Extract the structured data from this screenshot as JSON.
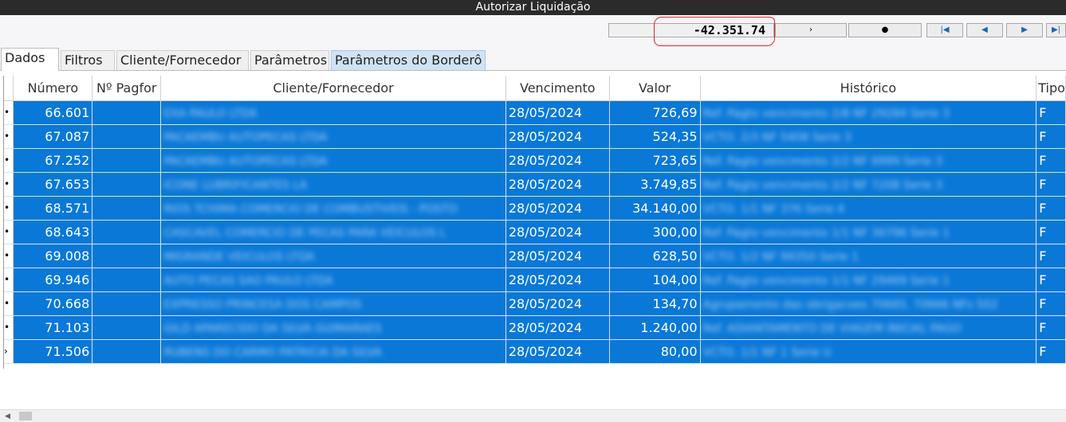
{
  "window": {
    "title": "Autorizar Liquidação"
  },
  "toolbar": {
    "total": "-42.351.74",
    "nav_next_glyph": "›",
    "nav_record_glyph": "●",
    "nav_first_glyph": "|◀",
    "nav_prev_glyph": "◀",
    "nav_forward_glyph": "▶",
    "nav_last_glyph": "▶|",
    "nav_color": "#1565c0",
    "highlight_color": "#e0232a"
  },
  "tabs": [
    {
      "label": "Dados"
    },
    {
      "label": "Filtros"
    },
    {
      "label": "Cliente/Fornecedor"
    },
    {
      "label": "Parâmetros"
    },
    {
      "label": "Parâmetros do Borderô"
    }
  ],
  "grid": {
    "columns": [
      "Número",
      "Nº Pagfor",
      "Cliente/Fornecedor",
      "Vencimento",
      "Valor",
      "Histórico",
      "Tipo"
    ],
    "row_color": "#0a78d7",
    "rows": [
      {
        "marker": "•",
        "numero": "66.601",
        "pagfor": "",
        "cliente": "EXA PAULO LTDA",
        "vencimento": "28/05/2024",
        "valor": "726,69",
        "historico": "Ref. Pagto vencimento 2/8 NF 29284 Serie 3",
        "tipo": "F"
      },
      {
        "marker": "•",
        "numero": "67.087",
        "pagfor": "",
        "cliente": "PACAEMBU AUTOPECAS LTDA",
        "vencimento": "28/05/2024",
        "valor": "524,35",
        "historico": "VCTO. 2/3 NF 5408 Serie 3",
        "tipo": "F"
      },
      {
        "marker": "•",
        "numero": "67.252",
        "pagfor": "",
        "cliente": "PACAEMBU AUTOPECAS LTDA",
        "vencimento": "28/05/2024",
        "valor": "723,65",
        "historico": "Ref. Pagto vencimento 2/2 NF 9999 Serie 3",
        "tipo": "F"
      },
      {
        "marker": "•",
        "numero": "67.653",
        "pagfor": "",
        "cliente": "ICONE LUBRIFICANTES LA",
        "vencimento": "28/05/2024",
        "valor": "3.749,85",
        "historico": "Ref. Pagto vencimento 2/2 NF 7208 Serie 3",
        "tipo": "F"
      },
      {
        "marker": "•",
        "numero": "68.571",
        "pagfor": "",
        "cliente": "RIOS TCHIMA COMERCIO DE COMBUSTIVEIS - POSTO",
        "vencimento": "28/05/2024",
        "valor": "34.140,00",
        "historico": "VCTO. 1/1 NF 376 Serie 4",
        "tipo": "F"
      },
      {
        "marker": "•",
        "numero": "68.643",
        "pagfor": "",
        "cliente": "CASCAVEL COMERCIO DE PECAS PARA VEICULOS L",
        "vencimento": "28/05/2024",
        "valor": "300,00",
        "historico": "Ref. Pagto vencimento 1/1 NF 36796 Serie 1",
        "tipo": "F"
      },
      {
        "marker": "•",
        "numero": "69.008",
        "pagfor": "",
        "cliente": "MIGRANDE VEICULOS LTDA",
        "vencimento": "28/05/2024",
        "valor": "628,50",
        "historico": "VCTO. 1/2 NF 99350 Serie 1",
        "tipo": "F"
      },
      {
        "marker": "•",
        "numero": "69.946",
        "pagfor": "",
        "cliente": "AUTO PECAS SAO PAULO LTDA",
        "vencimento": "28/05/2024",
        "valor": "104,00",
        "historico": "Ref. Pagto vencimento 1/1 NF 29469 Serie 1",
        "tipo": "F"
      },
      {
        "marker": "•",
        "numero": "70.668",
        "pagfor": "",
        "cliente": "EXPRESSO PRINCESA DOS CAMPOS",
        "vencimento": "28/05/2024",
        "valor": "134,70",
        "historico": "Agrupamento das obrigacoes 70665, 70666 NFs 502",
        "tipo": "F"
      },
      {
        "marker": "•",
        "numero": "71.103",
        "pagfor": "",
        "cliente": "GILD APARECIDO DA SILVA GUIMARAES",
        "vencimento": "28/05/2024",
        "valor": "1.240,00",
        "historico": "Ref. ADIANTAMENTO DE VIAGEM INICIAL PAGO",
        "tipo": "F"
      },
      {
        "marker": "›",
        "numero": "71.506",
        "pagfor": "",
        "cliente": "RUBENS DO CARMO PATRICIA DA SILVA",
        "vencimento": "28/05/2024",
        "valor": "80,00",
        "historico": "VCTO. 1/1 NF 1 Serie U",
        "tipo": "F"
      }
    ]
  }
}
